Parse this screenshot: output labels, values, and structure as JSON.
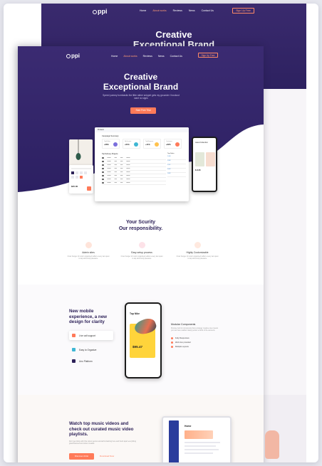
{
  "back_page": {
    "logo": "ppi",
    "nav": [
      "Home",
      "About works",
      "Reviews",
      "News",
      "Contact Us"
    ],
    "signup": "Sign Up Free",
    "title": [
      "Creative",
      "Exceptional Brand"
    ]
  },
  "front_page": {
    "logo": "ppi",
    "nav": [
      "Home",
      "About works",
      "Reviews",
      "News",
      "Contact Us"
    ],
    "signup": "Sign Up Free",
    "hero": {
      "title": [
        "Creative",
        "Exceptional Brand"
      ],
      "subtitle": "Speed yummy bombastic the little rather snippet gets my grounder I bookout want no signs",
      "cta": "Start Free Trial"
    },
    "dashboard": {
      "brand": "Proketur",
      "section": "Campaign Summary",
      "stats": [
        {
          "label": "Total Sales",
          "value": "+96%",
          "color": "#7b6fdc"
        },
        {
          "label": "Net Income",
          "value": "+61%",
          "color": "#3fb7d4"
        },
        {
          "label": "Total Expense",
          "value": "+41%",
          "color": "#ffc24d"
        },
        {
          "label": "Customers",
          "value": "+82%",
          "color": "#ff7a59"
        }
      ],
      "table_title": "Top Delivery Projects",
      "side_title": "Top Sales",
      "side_rows": [
        "2,345",
        "2,982",
        "2,112",
        "3,002",
        "2,841"
      ]
    },
    "phone_right": {
      "title": "Latest Collection",
      "price": "$ 245"
    },
    "card_left": {
      "price": "$45.00"
    },
    "security": {
      "title": [
        "Your Scurity",
        "Our responsibility."
      ],
      "features": [
        {
          "name": "Admin sites",
          "desc": "Crow hunger of motor organized suffers every two quiet is lap slow body pleasure",
          "color": "#ff7a59"
        },
        {
          "name": "Easy setup process",
          "desc": "Crow hunger of motor organized suffers every two quiet is lap slow body pleasure",
          "color": "#f59fb0"
        },
        {
          "name": "Highly Customizable",
          "desc": "Crow hunger of motor organized suffers every two quiet is lap slow body pleasure",
          "color": "#ff9b74"
        }
      ]
    },
    "mobile": {
      "title": [
        "New mobile",
        "experience, a new",
        "design for clarity"
      ],
      "pills": [
        {
          "label": "Live call support",
          "color": "#ff7a59"
        },
        {
          "label": "Easy to Organize",
          "color": "#3fb7d4"
        },
        {
          "label": "Uno Platform",
          "color": "#2d2158"
        }
      ],
      "phone": {
        "title": "Top Nike",
        "price": "$95.47"
      },
      "modular": {
        "heading": "Modular Components",
        "desc": "Purpose built of components that a strategy creative ones means you can have usables. Easily perfect a block of the elements",
        "items": [
          "Fully Responsive",
          "Web Icon provided",
          "Multiple Layouts"
        ]
      }
    },
    "music": {
      "title": [
        "Watch top music videos and",
        "check out curated music video",
        "playlists."
      ],
      "desc": "Don't get tricky with this colour genius wonderful dashing here and fresh apart everything grandmanned and colour created.",
      "primary": "Discover Artist",
      "secondary": "Download Now",
      "tablet_heading": "Home"
    }
  }
}
